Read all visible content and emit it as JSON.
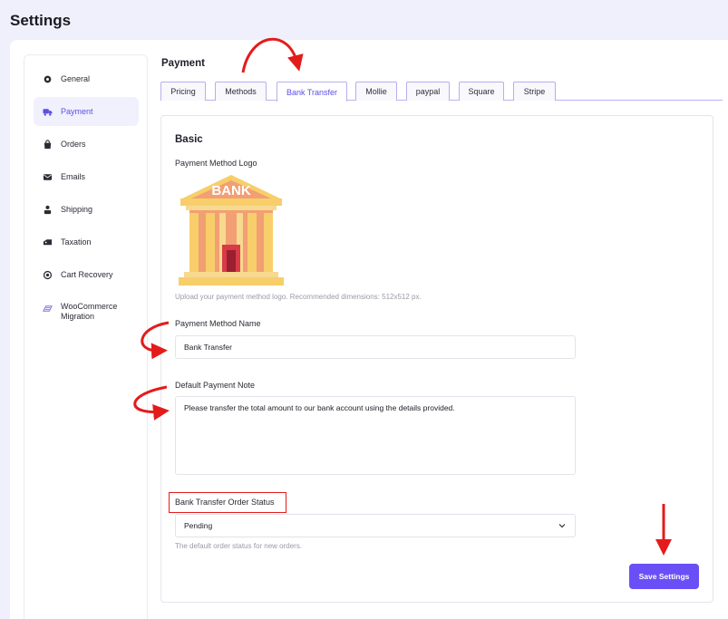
{
  "page": {
    "title": "Settings"
  },
  "sidebar": {
    "items": [
      {
        "label": "General",
        "icon": "gear-icon"
      },
      {
        "label": "Payment",
        "icon": "truck-icon",
        "active": true
      },
      {
        "label": "Orders",
        "icon": "bag-icon"
      },
      {
        "label": "Emails",
        "icon": "mail-icon"
      },
      {
        "label": "Shipping",
        "icon": "package-icon"
      },
      {
        "label": "Taxation",
        "icon": "tax-icon"
      },
      {
        "label": "Cart Recovery",
        "icon": "recovery-icon"
      },
      {
        "label_line1": "WooCommerce",
        "label_line2": "Migration",
        "icon": "migration-icon"
      }
    ]
  },
  "section": {
    "title": "Payment"
  },
  "tabs": [
    {
      "label": "Pricing"
    },
    {
      "label": "Methods"
    },
    {
      "label": "Bank Transfer",
      "active": true
    },
    {
      "label": "Mollie"
    },
    {
      "label": "paypal"
    },
    {
      "label": "Square"
    },
    {
      "label": "Stripe"
    }
  ],
  "form": {
    "card_title": "Basic",
    "logo": {
      "label": "Payment Method Logo",
      "sign_text": "BANK",
      "help": "Upload your payment method logo. Recommended dimensions: 512x512 px."
    },
    "method_name": {
      "label": "Payment Method Name",
      "value": "Bank Transfer"
    },
    "payment_note": {
      "label": "Default Payment Note",
      "value": "Please transfer the total amount to our bank account using the details provided."
    },
    "order_status": {
      "label": "Bank Transfer Order Status",
      "selected": "Pending",
      "help": "The default order status for new orders."
    },
    "save_label": "Save Settings"
  },
  "colors": {
    "accent": "#5b50e6",
    "button": "#6b4ff6",
    "annotation": "#e41b1b",
    "background": "#eff0fb"
  }
}
